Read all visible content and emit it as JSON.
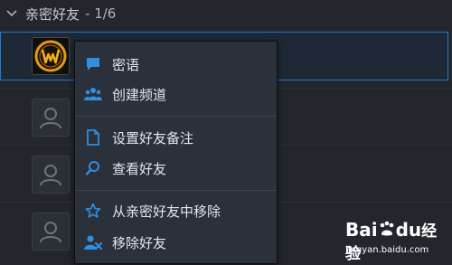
{
  "group": {
    "name": "亲密好友",
    "count": "- 1/6"
  },
  "context_menu": {
    "items": [
      {
        "label": "密语",
        "icon": "chat-bubble-icon"
      },
      {
        "label": "创建频道",
        "icon": "group-users-icon"
      },
      {
        "label": "设置好友备注",
        "icon": "document-icon"
      },
      {
        "label": "查看好友",
        "icon": "magnifier-icon"
      },
      {
        "label": "从亲密好友中移除",
        "icon": "star-icon"
      },
      {
        "label": "移除好友",
        "icon": "remove-user-icon"
      }
    ]
  },
  "watermark": {
    "brand_latin_a": "Bai",
    "brand_latin_b": "du",
    "brand_cn": "经验",
    "url": "jingyan.baidu.com"
  },
  "colors": {
    "accent_blue": "#1e7ad6",
    "icon_blue": "#2f8fe0",
    "background": "#23272d",
    "menu_bg": "#2b313b"
  }
}
